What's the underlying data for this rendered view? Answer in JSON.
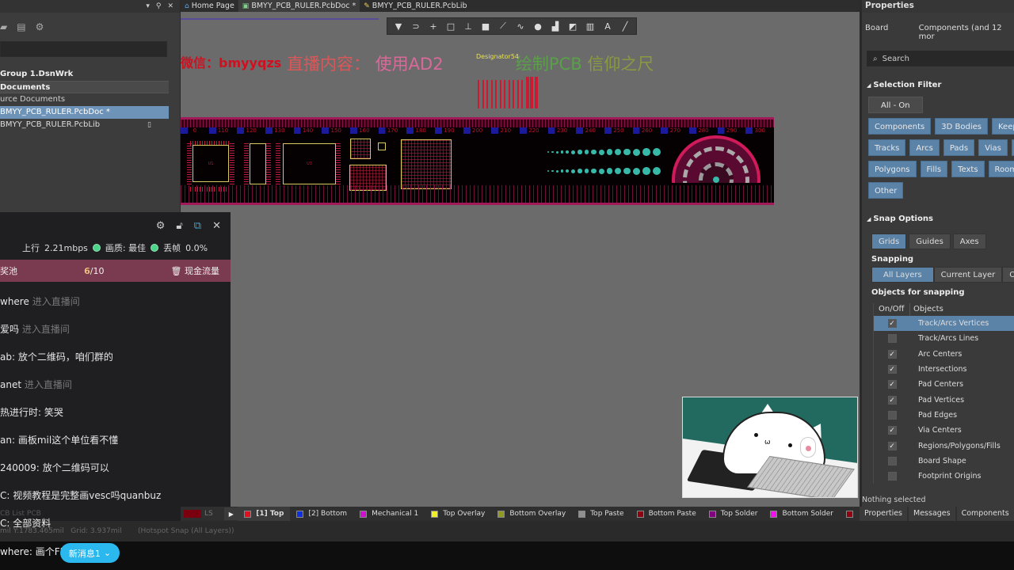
{
  "project_panel": {
    "title_controls": [
      "▾",
      "⚲",
      "✕"
    ],
    "toolbar_icons": [
      "folder-icon",
      "copy-icon",
      "gear-icon"
    ],
    "search_placeholder": "",
    "tree": [
      {
        "label": "Group 1.DsnWrk",
        "kind": "workspace"
      },
      {
        "label": "Documents",
        "kind": "group"
      },
      {
        "label": "urce Documents",
        "kind": "folder"
      },
      {
        "label": "BMYY_PCB_RULER.PcbDoc *",
        "kind": "file",
        "selected": true
      },
      {
        "label": "BMYY_PCB_RULER.PcbLib",
        "kind": "file",
        "selected": false
      }
    ]
  },
  "tabs": [
    {
      "label": "Home Page",
      "icon": "home-icon",
      "active": false
    },
    {
      "label": "BMYY_PCB_RULER.PcbDoc *",
      "icon": "pcb-doc-icon",
      "active": true
    },
    {
      "label": "BMYY_PCB_RULER.PcbLib",
      "icon": "pcb-lib-icon",
      "active": false
    }
  ],
  "pcb_toolbar": [
    {
      "name": "filter-icon",
      "glyph": "▼"
    },
    {
      "name": "route-icon",
      "glyph": "⊃"
    },
    {
      "name": "crosshair-icon",
      "glyph": "+"
    },
    {
      "name": "select-rect-icon",
      "glyph": "□"
    },
    {
      "name": "align-icon",
      "glyph": "⊥"
    },
    {
      "name": "component-icon",
      "glyph": "■"
    },
    {
      "name": "interactive-route-icon",
      "glyph": "⟋"
    },
    {
      "name": "diff-pair-icon",
      "glyph": "∿"
    },
    {
      "name": "via-icon",
      "glyph": "●"
    },
    {
      "name": "fill-icon",
      "glyph": "▟"
    },
    {
      "name": "rect-fill-icon",
      "glyph": "◩"
    },
    {
      "name": "chart-icon",
      "glyph": "▥"
    },
    {
      "name": "text-icon",
      "glyph": "A"
    },
    {
      "name": "line-icon",
      "glyph": "╱"
    }
  ],
  "canvas": {
    "banner": {
      "wechat": "微信：bmyyqzs",
      "part_a": "直播内容：",
      "part_b": "使用AD2",
      "part_c": "绘制PCB",
      "part_d": "信仰之尺"
    },
    "designator": "Designator54",
    "ruler_ticks": [
      "0",
      "110",
      "120",
      "130",
      "140",
      "150",
      "160",
      "170",
      "180",
      "190",
      "200",
      "210",
      "220",
      "230",
      "240",
      "250",
      "260",
      "270",
      "280",
      "290",
      "300"
    ]
  },
  "chat": {
    "header_icons": [
      "gear-icon",
      "lock-icon",
      "popout-icon",
      "close-icon"
    ],
    "upload_label": "上行",
    "upload_value": "2.21mbps",
    "quality_label": "画质: 最佳",
    "drop_label": "丢帧",
    "drop_value": "0.0%",
    "pool_label": "奖池",
    "pool_count_current": "6",
    "pool_count_total": "/10",
    "pool_action": "现金流量",
    "messages": [
      {
        "user": "where",
        "text": "",
        "sys": "进入直播间"
      },
      {
        "user": "爱吗",
        "text": "",
        "sys": "进入直播间"
      },
      {
        "user": "ab:",
        "text": "放个二维码，咱们群的",
        "sys": ""
      },
      {
        "user": "anet",
        "text": "",
        "sys": "进入直播间"
      },
      {
        "user": "热进行时:",
        "text": "笑哭",
        "sys": ""
      },
      {
        "user": "an:",
        "text": "画板mil这个单位看不懂",
        "sys": ""
      },
      {
        "user": "240009:",
        "text": "放个二维码可以",
        "sys": ""
      },
      {
        "user": "C:",
        "text": "视频教程是完整画vesc吗quanbuz",
        "sys": ""
      }
    ],
    "low_msg_1": "C: 全部资料",
    "low_msg_2": "where: 画个FP",
    "new_msg_button": "新消息1"
  },
  "statusbar": {
    "ls_label": "LS",
    "layers": [
      {
        "label": "[1] Top",
        "color": "#e01020",
        "active": true
      },
      {
        "label": "[2] Bottom",
        "color": "#1030e0",
        "active": false
      },
      {
        "label": "Mechanical 1",
        "color": "#d010d0",
        "active": false
      },
      {
        "label": "Top Overlay",
        "color": "#f0f020",
        "active": false
      },
      {
        "label": "Bottom Overlay",
        "color": "#909a20",
        "active": false
      },
      {
        "label": "Top Paste",
        "color": "#909090",
        "active": false
      },
      {
        "label": "Bottom Paste",
        "color": "#900010",
        "active": false
      },
      {
        "label": "Top Solder",
        "color": "#800080",
        "active": false
      },
      {
        "label": "Bottom Solder",
        "color": "#f010f0",
        "active": false
      },
      {
        "label": "",
        "color": "#900010",
        "active": false
      }
    ],
    "panel_labels": "CB List    PCB",
    "coords": "mil Y:1783.465mil",
    "grid": "Grid: 3.937mil",
    "snap": "(Hotspot Snap (All Layers))"
  },
  "properties": {
    "title": "Properties",
    "object_kind": "Board",
    "object_value": "Components (and 12 mor",
    "search_placeholder": "Search",
    "selection_filter": {
      "title": "Selection Filter",
      "all_on": "All - On",
      "rows": [
        [
          "Components",
          "3D Bodies",
          "Keepouts"
        ],
        [
          "Tracks",
          "Arcs",
          "Pads",
          "Vias",
          "Re"
        ],
        [
          "Polygons",
          "Fills",
          "Texts",
          "Rooms"
        ],
        [
          "Other"
        ]
      ]
    },
    "snap_options": {
      "title": "Snap Options",
      "modes": [
        {
          "label": "Grids",
          "on": true
        },
        {
          "label": "Guides",
          "on": false
        },
        {
          "label": "Axes",
          "on": false
        }
      ],
      "snapping_label": "Snapping",
      "snapping": [
        {
          "label": "All Layers",
          "on": true
        },
        {
          "label": "Current Layer",
          "on": false
        },
        {
          "label": "O",
          "on": false
        }
      ],
      "objects_label": "Objects for snapping",
      "col_onoff": "On/Off",
      "col_objects": "Objects",
      "objects": [
        {
          "label": "Track/Arcs Vertices",
          "checked": true,
          "selected": true
        },
        {
          "label": "Track/Arcs Lines",
          "checked": false,
          "selected": false
        },
        {
          "label": "Arc Centers",
          "checked": true,
          "selected": false
        },
        {
          "label": "Intersections",
          "checked": true,
          "selected": false
        },
        {
          "label": "Pad Centers",
          "checked": true,
          "selected": false
        },
        {
          "label": "Pad Vertices",
          "checked": true,
          "selected": false
        },
        {
          "label": "Pad Edges",
          "checked": false,
          "selected": false
        },
        {
          "label": "Via Centers",
          "checked": true,
          "selected": false
        },
        {
          "label": "Regions/Polygons/Fills",
          "checked": true,
          "selected": false
        },
        {
          "label": "Board Shape",
          "checked": false,
          "selected": false
        },
        {
          "label": "Footprint Origins",
          "checked": false,
          "selected": false
        }
      ]
    },
    "status": "Nothing selected",
    "bottom_tabs": [
      "Properties",
      "Messages",
      "Components"
    ]
  }
}
